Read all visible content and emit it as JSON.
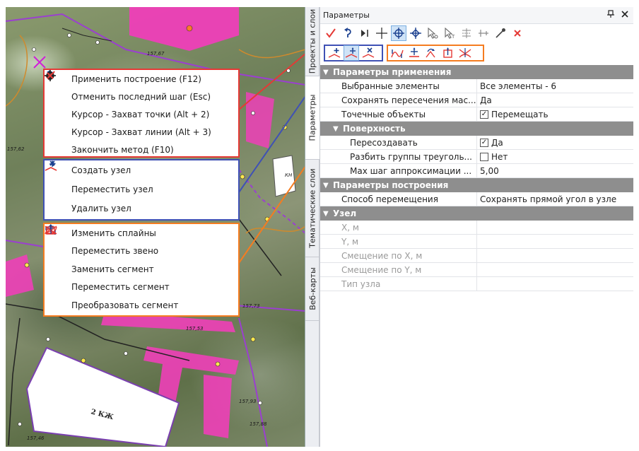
{
  "panel": {
    "title": "Параметры",
    "pin_icon": "pin-icon",
    "close_icon": "close-icon"
  },
  "tabs": [
    {
      "label": "Проекты и слои",
      "active": false
    },
    {
      "label": "Параметры",
      "active": true
    },
    {
      "label": "Тематические слои",
      "active": false
    },
    {
      "label": "Веб-карты",
      "active": false
    }
  ],
  "toolbar1": [
    {
      "icon": "apply-check-icon"
    },
    {
      "icon": "undo-step-icon"
    },
    {
      "icon": "skip-icon"
    },
    {
      "icon": "cross-cursor-icon"
    },
    {
      "icon": "point-capture-cursor-icon",
      "active": true
    },
    {
      "icon": "line-capture-cursor-icon"
    },
    {
      "icon": "select-arrow-icon"
    },
    {
      "icon": "select-text-arrow-icon"
    },
    {
      "icon": "snap-icon"
    },
    {
      "icon": "measure-icon"
    },
    {
      "icon": "eyedropper-icon"
    },
    {
      "icon": "finish-x-icon"
    }
  ],
  "toolbar2": {
    "node_tools": [
      "create-node-icon",
      "move-node-icon",
      "delete-node-icon"
    ],
    "segment_tools": [
      "edit-splines-icon",
      "move-link-icon",
      "replace-segment-icon",
      "move-segment-icon",
      "convert-segment-icon"
    ]
  },
  "legend": {
    "method": [
      {
        "icon": "apply-check-icon",
        "label": "Применить построение (F12)"
      },
      {
        "icon": "undo-step-icon",
        "label": "Отменить последний шаг (Esc)"
      },
      {
        "icon": "point-capture-cursor-icon",
        "label": "Курсор - Захват точки (Alt + 2)"
      },
      {
        "icon": "line-capture-cursor-icon",
        "label": "Курсор - Захват линии (Alt + 3)"
      },
      {
        "icon": "finish-x-icon",
        "label": "Закончить метод (F10)"
      }
    ],
    "nodes": [
      {
        "icon": "create-node-icon",
        "label": "Создать узел"
      },
      {
        "icon": "move-node-icon",
        "label": "Переместить узел"
      },
      {
        "icon": "delete-node-icon",
        "label": "Удалить узел"
      }
    ],
    "segments": [
      {
        "icon": "edit-splines-icon",
        "label": "Изменить сплайны"
      },
      {
        "icon": "move-link-icon",
        "label": "Переместить звено"
      },
      {
        "icon": "replace-segment-icon",
        "label": "Заменить сегмент"
      },
      {
        "icon": "move-segment-icon",
        "label": "Переместить сегмент"
      },
      {
        "icon": "convert-segment-icon",
        "label": "Преобразовать сегмент"
      }
    ]
  },
  "grid": {
    "cat_apply": "Параметры применения",
    "selected_label": "Выбранные элементы",
    "selected_value": "Все элементы - 6",
    "keep_label": "Сохранять пересечения мас...",
    "keep_value": "Да",
    "points_label": "Точечные объекты",
    "points_value": "Перемещать",
    "sub_surface": "Поверхность",
    "recreate_label": "Пересоздавать",
    "recreate_value": "Да",
    "split_label": "Разбить группы треуголь...",
    "split_value": "Нет",
    "maxstep_label": "Max шаг аппроксимации ...",
    "maxstep_value": "5,00",
    "cat_build": "Параметры построения",
    "move_method_label": "Способ перемещения",
    "move_method_value": "Сохранять прямой угол в узле",
    "cat_node": "Узел",
    "x_label": "X, м",
    "y_label": "Y, м",
    "dx_label": "Смещение по X, м",
    "dy_label": "Смещение по Y, м",
    "type_label": "Тип узла"
  },
  "map": {
    "labels": [
      "157,67",
      "157,62",
      "157,73",
      "157,53",
      "157,93",
      "157,88",
      "157,46",
      "2 КЖ",
      "КН"
    ]
  }
}
